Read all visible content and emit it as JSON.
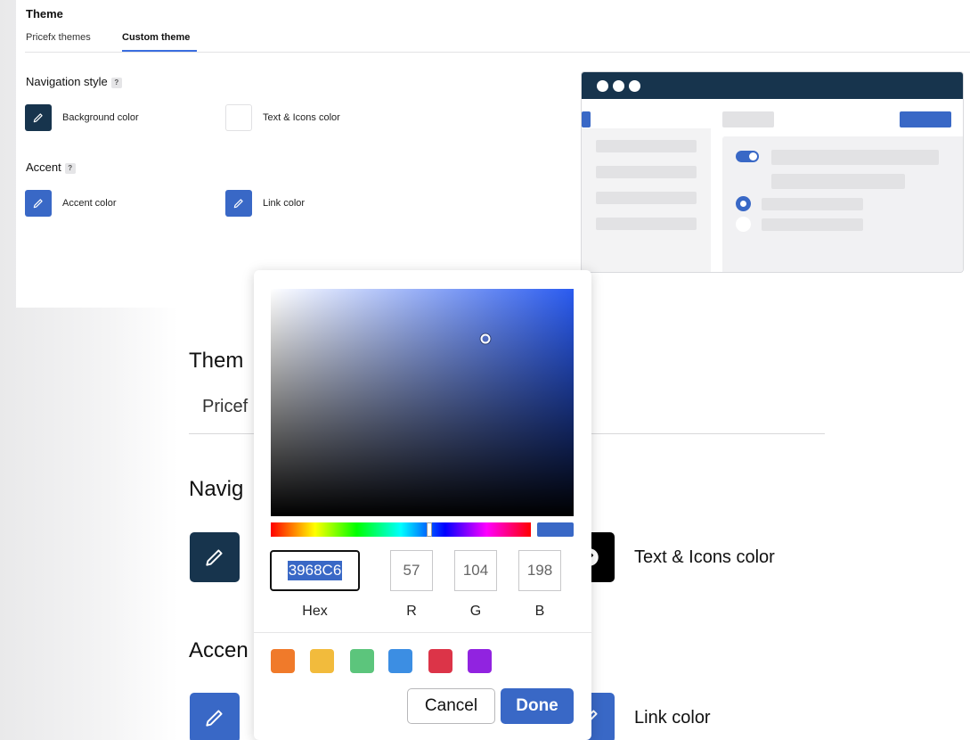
{
  "background": {
    "section_title": "Them",
    "tab_partial": "Pricef",
    "nav_heading": "Navig",
    "accent_heading": "Accen",
    "text_icons_label": "Text & Icons color",
    "link_label": "Link color"
  },
  "card": {
    "title": "Theme",
    "tabs": [
      {
        "label": "Pricefx themes",
        "active": false
      },
      {
        "label": "Custom theme",
        "active": true
      }
    ],
    "navigation": {
      "heading": "Navigation style",
      "help": "?",
      "items": [
        {
          "label": "Background color",
          "color": "#17344d"
        },
        {
          "label": "Text & Icons color",
          "color": "#ffffff"
        }
      ]
    },
    "accent": {
      "heading": "Accent",
      "help": "?",
      "items": [
        {
          "label": "Accent color",
          "color": "#3968c6"
        },
        {
          "label": "Link color",
          "color": "#3968c6"
        }
      ]
    }
  },
  "picker": {
    "hex": "3968C6",
    "r": "57",
    "g": "104",
    "b": "198",
    "labels": {
      "hex": "Hex",
      "r": "R",
      "g": "G",
      "b": "B"
    },
    "presets": [
      "#f07a2a",
      "#f2bb3c",
      "#5cc57c",
      "#3c8ee3",
      "#dc3448",
      "#9123e0"
    ],
    "cancel_label": "Cancel",
    "done_label": "Done",
    "saturation": 0.71,
    "brightness": 0.78,
    "hue_fraction": 0.61
  }
}
